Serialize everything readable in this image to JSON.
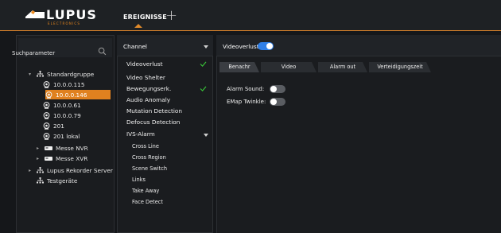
{
  "app": {
    "logo_text": "LUPUS",
    "logo_sub": "ELECTRONICS",
    "active_tab": "EREIGNISSE",
    "add_tab_symbol": "+"
  },
  "sidebar": {
    "search_label": "Suchparameter",
    "tree": [
      {
        "label": "Standardgruppe",
        "level": 0,
        "icon": "group-icon",
        "chevron": "expanded"
      },
      {
        "label": "10.0.0.115",
        "level": 1,
        "icon": "camera-icon"
      },
      {
        "label": "10.0.0.146",
        "level": 1,
        "icon": "camera-icon",
        "selected": true
      },
      {
        "label": "10.0.0.61",
        "level": 1,
        "icon": "camera-icon"
      },
      {
        "label": "10.0.0.79",
        "level": 1,
        "icon": "camera-icon"
      },
      {
        "label": "201",
        "level": 1,
        "icon": "camera-icon"
      },
      {
        "label": "201 lokal",
        "level": 1,
        "icon": "camera-icon"
      },
      {
        "label": "Messe NVR",
        "level": 1,
        "icon": "recorder-icon",
        "chevron": "collapsed"
      },
      {
        "label": "Messe XVR",
        "level": 1,
        "icon": "recorder-icon",
        "chevron": "collapsed"
      },
      {
        "label": "Lupus Rekorder Server",
        "level": 0,
        "icon": "group-icon",
        "chevron": "collapsed"
      },
      {
        "label": "Testgeräte",
        "level": 0,
        "icon": "group-icon"
      }
    ]
  },
  "channel_panel": {
    "header": "Channel",
    "items": [
      {
        "label": "Videoverlust",
        "checked": true
      },
      {
        "label": "Video Shelter",
        "checked": false
      },
      {
        "label": "Bewegungserk.",
        "checked": true
      },
      {
        "label": "Audio Anomaly",
        "checked": false
      },
      {
        "label": "Mutation Detection",
        "checked": false
      },
      {
        "label": "Defocus Detection",
        "checked": false
      },
      {
        "label": "IVS-Alarm",
        "checked": false,
        "expanded": true
      }
    ],
    "ivs_subitems": [
      "Cross Line",
      "Cross Region",
      "Scene Switch",
      "Links",
      "Take Away",
      "Face Detect"
    ]
  },
  "detail": {
    "title": "Videoverlust",
    "enabled": true,
    "tabs": [
      "Benachr",
      "Video",
      "Alarm out",
      "Verteidigungszeit"
    ],
    "active_tab": "Benachr",
    "fields": [
      {
        "label": "Alarm Sound:",
        "enabled": false
      },
      {
        "label": "EMap Twinkle:",
        "enabled": false
      }
    ]
  },
  "colors": {
    "accent_orange": "#e0811f",
    "toggle_on": "#2f7fe8",
    "check_green": "#39c439"
  }
}
